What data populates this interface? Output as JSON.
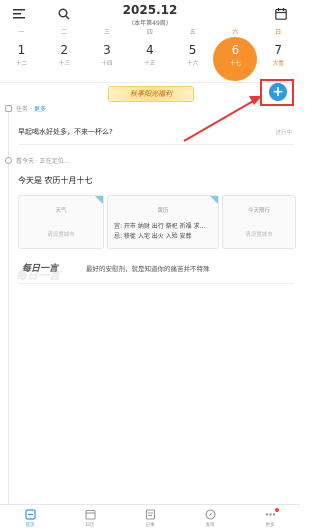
{
  "header": {
    "title": "2025.12",
    "subtitle": "(本年第49周)",
    "menu_icon": "menu-icon",
    "search_icon": "search-icon",
    "calendar_icon": "calendar-icon"
  },
  "week": {
    "weekdays": [
      "一",
      "二",
      "三",
      "四",
      "五",
      "六",
      "日"
    ],
    "days": [
      {
        "num": "1",
        "lunar": "十二"
      },
      {
        "num": "2",
        "lunar": "十三"
      },
      {
        "num": "3",
        "lunar": "十四"
      },
      {
        "num": "4",
        "lunar": "十五"
      },
      {
        "num": "5",
        "lunar": "十六"
      },
      {
        "num": "6",
        "lunar": "十七"
      },
      {
        "num": "7",
        "lunar": "大雪"
      }
    ],
    "today_color": "#f7912c"
  },
  "banner": {
    "text": "秋季阳光福利"
  },
  "add_button": {
    "label": "+"
  },
  "tasks": {
    "label": "任务",
    "more": "· 更多",
    "item": "早起喝水好处多，不来一杯么?",
    "item_right": "进行中"
  },
  "today": {
    "header": "看今天 · 正在定位...",
    "title": "今天是 农历十月十七"
  },
  "cards": {
    "weather": {
      "title": "天气",
      "body": "请设置城市"
    },
    "almanac": {
      "title": "黄历",
      "yi": "宜: 开市 纳财 出行 祭祀 祈福 求...",
      "ji": "忌: 移徙 入宅 出火 入殓 安葬"
    },
    "traffic": {
      "title": "今天限行",
      "body": "请设置城市"
    }
  },
  "quote": {
    "badge": "每日一言",
    "text": "最好的安慰剂，就是知道你的痛苦并不特殊"
  },
  "nav": [
    {
      "label": "首页",
      "icon": "home-icon"
    },
    {
      "label": "日历",
      "icon": "calendar-icon"
    },
    {
      "label": "记事",
      "icon": "note-icon"
    },
    {
      "label": "发现",
      "icon": "compass-icon"
    },
    {
      "label": "更多",
      "icon": "more-icon"
    }
  ],
  "colors": {
    "accent": "#2e9bdc",
    "today": "#f7912c",
    "highlight": "#e53935"
  }
}
